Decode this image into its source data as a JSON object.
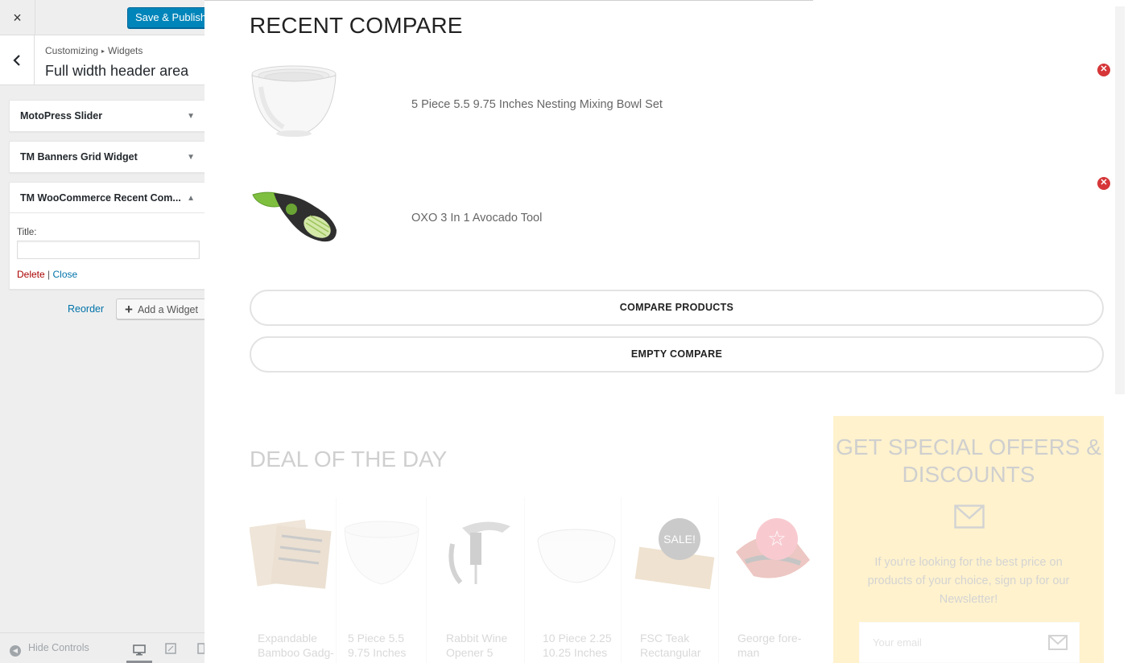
{
  "topbar": {
    "close_icon": "×",
    "save_label": "Save & Publish"
  },
  "section": {
    "crumb_root": "Customizing",
    "crumb_sep": "▸",
    "crumb_leaf": "Widgets",
    "title": "Full width header area"
  },
  "widgets": [
    {
      "title": "MotoPress Slider",
      "state": "collapsed"
    },
    {
      "title": "TM Banners Grid Widget",
      "state": "collapsed"
    },
    {
      "title": "TM WooCommerce Recent Com...",
      "state": "expanded"
    }
  ],
  "widget_form": {
    "title_label": "Title:",
    "title_value": "",
    "delete_label": "Delete",
    "separator": "|",
    "close_label": "Close"
  },
  "actions": {
    "reorder_label": "Reorder",
    "add_widget_label": "Add a Widget"
  },
  "footer": {
    "hide_controls_label": "Hide Controls",
    "devices": [
      "desktop",
      "tablet",
      "mobile"
    ],
    "active_device": "desktop"
  },
  "compare": {
    "title": "RECENT COMPARE",
    "products": [
      {
        "name": "5 Piece 5.5 9.75 Inches Nesting Mixing Bowl Set",
        "image_icon": "mixing-bowl-image"
      },
      {
        "name": "OXO 3 In 1 Avocado Tool",
        "image_icon": "avocado-tool-image"
      }
    ],
    "compare_button": "COMPARE PRODUCTS",
    "empty_button": "EMPTY COMPARE"
  },
  "deal": {
    "title": "DEAL OF THE DAY",
    "items": [
      {
        "name": "Expandable Bamboo Gadg-"
      },
      {
        "name": "5 Piece 5.5 9.75 Inches"
      },
      {
        "name": "Rabbit Wine Opener 5"
      },
      {
        "name": "10 Piece 2.25 10.25 Inches"
      },
      {
        "name": "FSC Teak Rectangular",
        "badge": "SALE!"
      },
      {
        "name": "George fore-man",
        "badge": "☆"
      }
    ]
  },
  "offers": {
    "title": "GET SPECIAL OFFERS & DISCOUNTS",
    "text": "If you're looking for the best price on products of your choice, sign up for our Newsletter!",
    "email_placeholder": "Your email",
    "background": "#ffd44f"
  },
  "colors": {
    "primary_button": "#0085ba",
    "link": "#0073aa",
    "delete": "#aa0000",
    "remove": "#d63638"
  }
}
